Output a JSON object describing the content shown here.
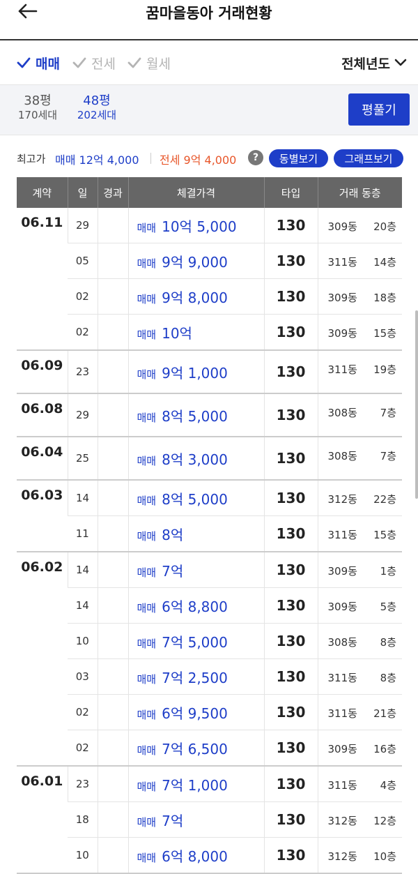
{
  "header": {
    "title": "꿈마을동아 거래현황",
    "back_icon": "back-arrow-icon"
  },
  "trade_filters": [
    {
      "label": "매매",
      "checked": true
    },
    {
      "label": "전세",
      "checked": false
    },
    {
      "label": "월세",
      "checked": false
    }
  ],
  "year_select": {
    "label": "전체년도"
  },
  "sizes": [
    {
      "name": "38평",
      "count": "170세대",
      "active": false
    },
    {
      "name": "48평",
      "count": "202세대",
      "active": true
    }
  ],
  "pyeong_button": "평풀기",
  "max_price": {
    "label": "최고가",
    "sale": "매매 12억 4,000",
    "jeonse": "전세 9억 4,000"
  },
  "buttons": {
    "by_dong": "동별보기",
    "graph": "그래프보기"
  },
  "table": {
    "headers": [
      "계약",
      "일",
      "경과",
      "체결가격",
      "타입",
      "거래 동층"
    ],
    "groups": [
      {
        "date": "06.11",
        "rows": [
          {
            "day": "29",
            "kind": "매매",
            "price": "10억 5,000",
            "type": "130",
            "dong": "309동",
            "floor": "20층"
          },
          {
            "day": "05",
            "kind": "매매",
            "price": "9억 9,000",
            "type": "130",
            "dong": "311동",
            "floor": "14층"
          },
          {
            "day": "02",
            "kind": "매매",
            "price": "9억 8,000",
            "type": "130",
            "dong": "309동",
            "floor": "18층"
          },
          {
            "day": "02",
            "kind": "매매",
            "price": "10억",
            "type": "130",
            "dong": "309동",
            "floor": "15층"
          }
        ]
      },
      {
        "date": "06.09",
        "rows": [
          {
            "day": "23",
            "kind": "매매",
            "price": "9억 1,000",
            "type": "130",
            "dong": "311동",
            "floor": "19층"
          }
        ]
      },
      {
        "date": "06.08",
        "rows": [
          {
            "day": "29",
            "kind": "매매",
            "price": "8억 5,000",
            "type": "130",
            "dong": "308동",
            "floor": "7층"
          }
        ]
      },
      {
        "date": "06.04",
        "rows": [
          {
            "day": "25",
            "kind": "매매",
            "price": "8억 3,000",
            "type": "130",
            "dong": "308동",
            "floor": "7층"
          }
        ]
      },
      {
        "date": "06.03",
        "rows": [
          {
            "day": "14",
            "kind": "매매",
            "price": "8억 5,000",
            "type": "130",
            "dong": "312동",
            "floor": "22층"
          },
          {
            "day": "11",
            "kind": "매매",
            "price": "8억",
            "type": "130",
            "dong": "311동",
            "floor": "15층"
          }
        ]
      },
      {
        "date": "06.02",
        "rows": [
          {
            "day": "14",
            "kind": "매매",
            "price": "7억",
            "type": "130",
            "dong": "309동",
            "floor": "1층"
          },
          {
            "day": "14",
            "kind": "매매",
            "price": "6억 8,800",
            "type": "130",
            "dong": "309동",
            "floor": "5층"
          },
          {
            "day": "10",
            "kind": "매매",
            "price": "7억 5,000",
            "type": "130",
            "dong": "308동",
            "floor": "8층"
          },
          {
            "day": "03",
            "kind": "매매",
            "price": "7억 2,500",
            "type": "130",
            "dong": "311동",
            "floor": "8층"
          },
          {
            "day": "02",
            "kind": "매매",
            "price": "6억 9,500",
            "type": "130",
            "dong": "311동",
            "floor": "21층"
          },
          {
            "day": "02",
            "kind": "매매",
            "price": "7억 6,500",
            "type": "130",
            "dong": "309동",
            "floor": "16층"
          }
        ]
      },
      {
        "date": "06.01",
        "rows": [
          {
            "day": "23",
            "kind": "매매",
            "price": "7억 1,000",
            "type": "130",
            "dong": "311동",
            "floor": "4층"
          },
          {
            "day": "18",
            "kind": "매매",
            "price": "7억",
            "type": "130",
            "dong": "312동",
            "floor": "12층"
          },
          {
            "day": "10",
            "kind": "매매",
            "price": "6억 8,000",
            "type": "130",
            "dong": "312동",
            "floor": "10층"
          }
        ]
      }
    ]
  },
  "colors": {
    "accent": "#1e3ec8",
    "jeonse": "#e8562a",
    "header_bg": "#666666",
    "inactive": "#b4b4b4"
  }
}
